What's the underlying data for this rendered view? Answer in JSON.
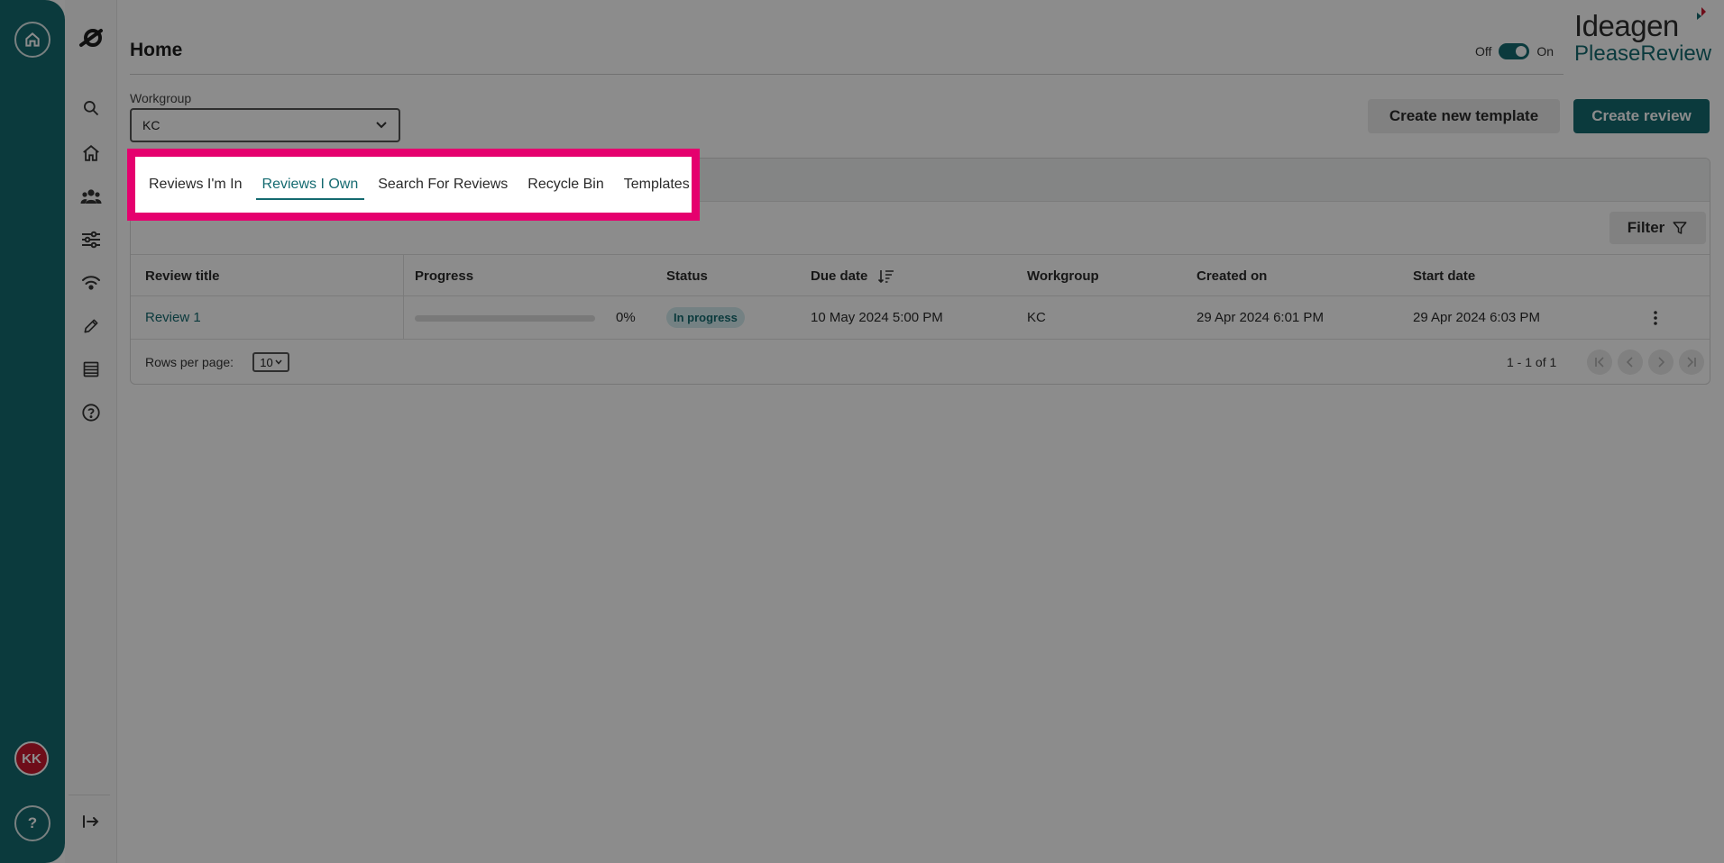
{
  "page": {
    "title": "Home"
  },
  "toggle": {
    "off_label": "Off",
    "on_label": "On",
    "state": "on"
  },
  "brand": {
    "line1": "Ideagen",
    "line2": "PleaseReview"
  },
  "rail": {
    "avatar_initials": "KK",
    "help_glyph": "?"
  },
  "sidebar": {
    "icons": [
      "search-icon",
      "home-icon",
      "users-icon",
      "sliders-icon",
      "signal-icon",
      "pen-icon",
      "list-icon",
      "help-circle-icon",
      "collapse-icon"
    ]
  },
  "workgroup": {
    "label": "Workgroup",
    "value": "KC"
  },
  "actions": {
    "create_template": "Create new template",
    "create_review": "Create review"
  },
  "tabs": [
    {
      "label": "Reviews I'm In",
      "active": false
    },
    {
      "label": "Reviews I Own",
      "active": true
    },
    {
      "label": "Search For Reviews",
      "active": false
    },
    {
      "label": "Recycle Bin",
      "active": false
    },
    {
      "label": "Templates",
      "active": false
    }
  ],
  "filter": {
    "label": "Filter"
  },
  "table": {
    "columns": [
      "Review title",
      "Progress",
      "Status",
      "Due date",
      "Workgroup",
      "Created on",
      "Start date"
    ],
    "rows": [
      {
        "title": "Review 1",
        "progress_text": "0%",
        "progress": 0,
        "status": "In progress",
        "due_date": "10 May 2024 5:00 PM",
        "workgroup": "KC",
        "created_on": "29 Apr 2024 6:01 PM",
        "start_date": "29 Apr 2024 6:03 PM"
      }
    ]
  },
  "pagination": {
    "rows_per_page_label": "Rows per page:",
    "rows_per_page": "10",
    "range": "1 - 1 of 1"
  },
  "colors": {
    "brand_teal": "#146a70",
    "highlight": "#e5006e",
    "avatar_red": "#c8182e"
  }
}
